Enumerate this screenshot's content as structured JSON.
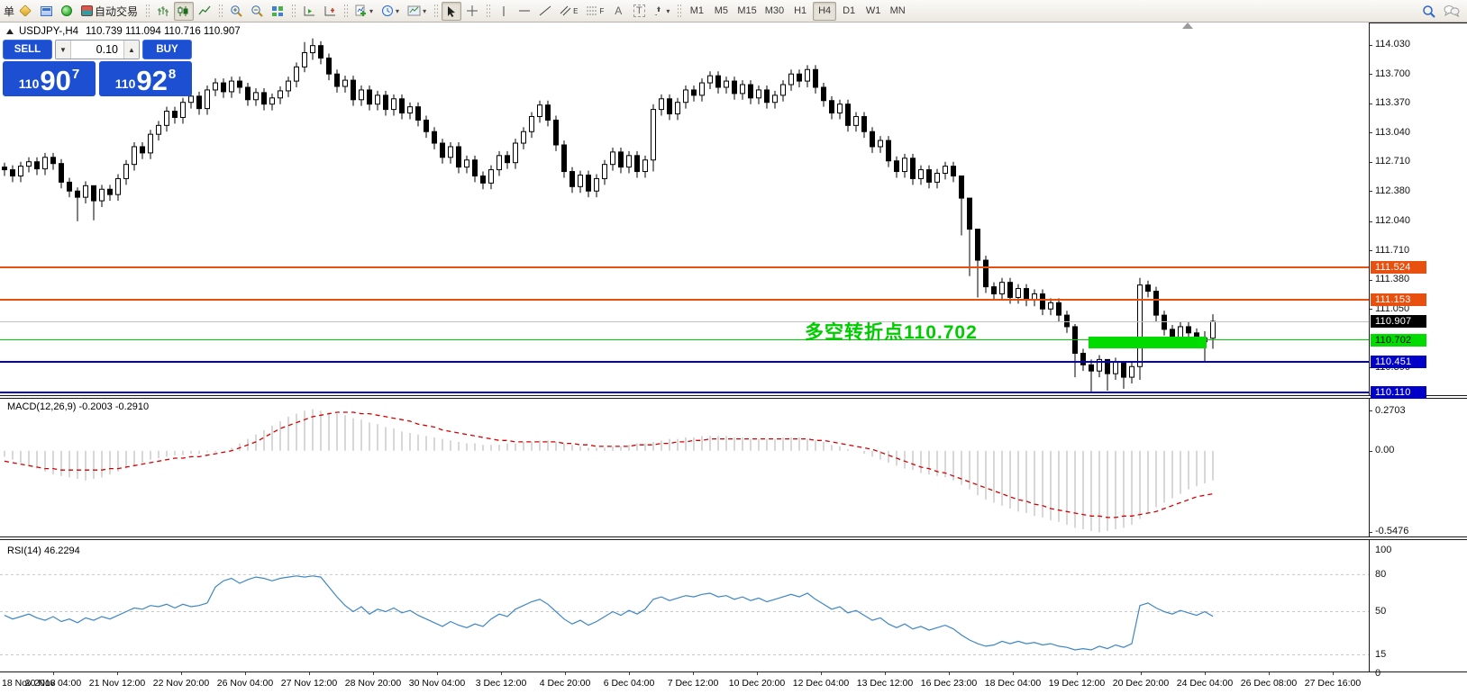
{
  "toolbar": {
    "order_label": "单",
    "autotrading_label": "自动交易",
    "timeframes": [
      "M1",
      "M5",
      "M15",
      "M30",
      "H1",
      "H4",
      "D1",
      "W1",
      "MN"
    ],
    "active_timeframe": "H4",
    "glyph_text": "A",
    "glyph_label": "T",
    "glyph_channel": "E",
    "glyph_fibo": "F"
  },
  "title": {
    "symbol": "USDJPY-,H4",
    "ohlc": "110.739 111.094 110.716 110.907"
  },
  "trade": {
    "sell": "SELL",
    "buy": "BUY",
    "volume": "0.10",
    "bid_prefix": "110",
    "bid_big": "90",
    "bid_sup": "7",
    "ask_prefix": "110",
    "ask_big": "92",
    "ask_sup": "8"
  },
  "annotation": {
    "text": "多空转折点110.702",
    "color": "#00CC00"
  },
  "axis": {
    "ticks": [
      "114.030",
      "113.700",
      "113.370",
      "113.040",
      "112.710",
      "112.380",
      "112.040",
      "111.710",
      "111.380",
      "111.050",
      "110.390"
    ],
    "badges": [
      {
        "text": "111.524",
        "price": 111.524,
        "bg": "#E8500F",
        "fg": "#FFFFFF"
      },
      {
        "text": "111.153",
        "price": 111.153,
        "bg": "#E8500F",
        "fg": "#FFFFFF"
      },
      {
        "text": "110.907",
        "price": 110.907,
        "bg": "#000000",
        "fg": "#FFFFFF"
      },
      {
        "text": "110.702",
        "price": 110.702,
        "bg": "#00DC00",
        "fg": "#000000"
      },
      {
        "text": "110.451",
        "price": 110.451,
        "bg": "#0000C8",
        "fg": "#FFFFFF"
      },
      {
        "text": "110.110",
        "price": 110.11,
        "bg": "#0000C8",
        "fg": "#FFFFFF"
      }
    ]
  },
  "levels": [
    {
      "price": 111.524,
      "color": "#E8500F",
      "w": 2
    },
    {
      "price": 111.153,
      "color": "#E8500F",
      "w": 2
    },
    {
      "price": 110.907,
      "color": "#C0C0C0",
      "w": 1
    },
    {
      "price": 110.702,
      "color": "#00CC00",
      "w": 1
    },
    {
      "price": 110.451,
      "color": "#0000C8",
      "w": 2
    },
    {
      "price": 110.11,
      "color": "#0000C8",
      "w": 2
    }
  ],
  "highlight_rect": {
    "color": "#00DC00"
  },
  "macd": {
    "label": "MACD(12,26,9) -0.2003 -0.2910",
    "axis_max": "0.2703",
    "axis_zero": "0.00",
    "axis_min": "-0.5476"
  },
  "rsi": {
    "label": "RSI(14) 46.2294",
    "axis": [
      100,
      80,
      50,
      15,
      0
    ]
  },
  "time_axis": [
    "18 Nov 2018",
    "20 Nov 04:00",
    "21 Nov 12:00",
    "22 Nov 20:00",
    "26 Nov 04:00",
    "27 Nov 12:00",
    "28 Nov 20:00",
    "30 Nov 04:00",
    "3 Dec 12:00",
    "4 Dec 20:00",
    "6 Dec 04:00",
    "7 Dec 12:00",
    "10 Dec 20:00",
    "12 Dec 04:00",
    "13 Dec 12:00",
    "16 Dec 23:00",
    "18 Dec 04:00",
    "19 Dec 12:00",
    "20 Dec 20:00",
    "24 Dec 04:00",
    "26 Dec 08:00",
    "27 Dec 16:00"
  ],
  "chart_data": {
    "type": "candlestick",
    "symbol": "USDJPY",
    "period": "H4",
    "price_axis_range": [
      110.05,
      114.27
    ],
    "candles": {
      "first_open": 112.65,
      "closes": [
        112.62,
        112.55,
        112.66,
        112.71,
        112.63,
        112.76,
        112.69,
        112.48,
        112.38,
        112.31,
        112.44,
        112.27,
        112.4,
        112.34,
        112.52,
        112.68,
        112.88,
        112.81,
        113.02,
        113.12,
        113.28,
        113.21,
        113.38,
        113.45,
        113.31,
        113.52,
        113.6,
        113.5,
        113.62,
        113.55,
        113.41,
        113.49,
        113.36,
        113.43,
        113.51,
        113.62,
        113.78,
        113.94,
        114.02,
        113.88,
        113.7,
        113.56,
        113.63,
        113.41,
        113.52,
        113.36,
        113.46,
        113.3,
        113.42,
        113.26,
        113.33,
        113.18,
        113.05,
        112.92,
        112.76,
        112.88,
        112.65,
        112.73,
        112.55,
        112.47,
        112.62,
        112.78,
        112.7,
        112.92,
        113.05,
        113.22,
        113.35,
        113.18,
        112.9,
        112.6,
        112.43,
        112.56,
        112.38,
        112.52,
        112.68,
        112.82,
        112.65,
        112.78,
        112.6,
        112.73,
        113.3,
        113.42,
        113.25,
        113.38,
        113.52,
        113.46,
        113.6,
        113.68,
        113.55,
        113.62,
        113.48,
        113.58,
        113.43,
        113.52,
        113.38,
        113.46,
        113.58,
        113.7,
        113.62,
        113.75,
        113.55,
        113.4,
        113.26,
        113.36,
        113.12,
        113.22,
        113.05,
        112.88,
        112.95,
        112.72,
        112.6,
        112.75,
        112.52,
        112.62,
        112.48,
        112.58,
        112.66,
        112.55,
        112.3,
        111.95,
        111.6,
        111.3,
        111.22,
        111.35,
        111.18,
        111.28,
        111.15,
        111.22,
        111.05,
        111.12,
        110.98,
        110.85,
        110.55,
        110.42,
        110.35,
        110.48,
        110.32,
        110.45,
        110.28,
        110.4,
        111.32,
        111.25,
        110.98,
        110.82,
        110.72,
        110.85,
        110.78,
        110.68,
        110.72,
        110.91
      ],
      "wick_overrides": {
        "9": [
          112.42,
          112.04
        ],
        "11": [
          112.38,
          112.05
        ],
        "37": [
          114.06,
          113.72
        ],
        "38": [
          114.1,
          113.86
        ],
        "80": [
          113.36,
          112.6
        ],
        "118": [
          112.52,
          111.88
        ],
        "119": [
          112.0,
          111.42
        ],
        "120": [
          111.68,
          111.18
        ],
        "132": [
          110.88,
          110.28
        ],
        "134": [
          110.48,
          110.12
        ],
        "136": [
          110.45,
          110.13
        ],
        "138": [
          110.38,
          110.15
        ],
        "140": [
          111.4,
          110.25
        ],
        "148": [
          110.8,
          110.45
        ],
        "149": [
          110.99,
          110.6
        ]
      }
    },
    "macd": {
      "histogram": [
        -0.04,
        -0.06,
        -0.08,
        -0.1,
        -0.12,
        -0.14,
        -0.16,
        -0.17,
        -0.18,
        -0.19,
        -0.2,
        -0.19,
        -0.18,
        -0.16,
        -0.14,
        -0.12,
        -0.1,
        -0.08,
        -0.06,
        -0.05,
        -0.04,
        -0.03,
        -0.03,
        -0.02,
        -0.02,
        -0.01,
        -0.01,
        0.0,
        0.02,
        0.05,
        0.08,
        0.11,
        0.14,
        0.17,
        0.2,
        0.23,
        0.25,
        0.27,
        0.28,
        0.27,
        0.26,
        0.25,
        0.24,
        0.22,
        0.21,
        0.19,
        0.18,
        0.16,
        0.15,
        0.13,
        0.12,
        0.11,
        0.1,
        0.09,
        0.08,
        0.07,
        0.06,
        0.05,
        0.05,
        0.04,
        0.04,
        0.04,
        0.05,
        0.05,
        0.06,
        0.06,
        0.07,
        0.07,
        0.06,
        0.05,
        0.04,
        0.03,
        0.02,
        0.02,
        0.02,
        0.03,
        0.03,
        0.04,
        0.05,
        0.05,
        0.06,
        0.07,
        0.08,
        0.08,
        0.09,
        0.09,
        0.1,
        0.1,
        0.1,
        0.1,
        0.09,
        0.09,
        0.08,
        0.08,
        0.08,
        0.08,
        0.09,
        0.09,
        0.09,
        0.08,
        0.07,
        0.06,
        0.04,
        0.03,
        0.01,
        0.0,
        -0.02,
        -0.04,
        -0.06,
        -0.08,
        -0.1,
        -0.12,
        -0.13,
        -0.15,
        -0.16,
        -0.17,
        -0.18,
        -0.2,
        -0.23,
        -0.26,
        -0.3,
        -0.33,
        -0.35,
        -0.37,
        -0.39,
        -0.41,
        -0.42,
        -0.44,
        -0.45,
        -0.47,
        -0.48,
        -0.5,
        -0.52,
        -0.53,
        -0.54,
        -0.55,
        -0.54,
        -0.53,
        -0.52,
        -0.5,
        -0.46,
        -0.42,
        -0.38,
        -0.35,
        -0.32,
        -0.29,
        -0.26,
        -0.24,
        -0.22,
        -0.2
      ],
      "signal": [
        -0.07,
        -0.08,
        -0.09,
        -0.1,
        -0.11,
        -0.12,
        -0.12,
        -0.13,
        -0.13,
        -0.13,
        -0.13,
        -0.13,
        -0.13,
        -0.12,
        -0.12,
        -0.11,
        -0.1,
        -0.09,
        -0.08,
        -0.07,
        -0.06,
        -0.05,
        -0.05,
        -0.04,
        -0.04,
        -0.03,
        -0.02,
        -0.01,
        0.0,
        0.02,
        0.04,
        0.06,
        0.09,
        0.12,
        0.15,
        0.17,
        0.19,
        0.21,
        0.23,
        0.24,
        0.25,
        0.26,
        0.26,
        0.26,
        0.25,
        0.25,
        0.24,
        0.23,
        0.22,
        0.21,
        0.2,
        0.18,
        0.17,
        0.16,
        0.14,
        0.13,
        0.12,
        0.11,
        0.1,
        0.09,
        0.08,
        0.07,
        0.07,
        0.06,
        0.06,
        0.06,
        0.06,
        0.06,
        0.06,
        0.05,
        0.05,
        0.04,
        0.04,
        0.03,
        0.03,
        0.03,
        0.03,
        0.03,
        0.04,
        0.04,
        0.04,
        0.05,
        0.05,
        0.06,
        0.06,
        0.07,
        0.07,
        0.08,
        0.08,
        0.08,
        0.08,
        0.08,
        0.08,
        0.08,
        0.08,
        0.08,
        0.08,
        0.08,
        0.08,
        0.08,
        0.07,
        0.07,
        0.06,
        0.05,
        0.04,
        0.03,
        0.02,
        0.01,
        -0.01,
        -0.03,
        -0.05,
        -0.07,
        -0.09,
        -0.11,
        -0.12,
        -0.14,
        -0.15,
        -0.17,
        -0.19,
        -0.21,
        -0.23,
        -0.25,
        -0.27,
        -0.29,
        -0.31,
        -0.33,
        -0.34,
        -0.36,
        -0.37,
        -0.39,
        -0.4,
        -0.41,
        -0.42,
        -0.43,
        -0.44,
        -0.44,
        -0.45,
        -0.45,
        -0.44,
        -0.44,
        -0.43,
        -0.42,
        -0.41,
        -0.39,
        -0.37,
        -0.35,
        -0.33,
        -0.31,
        -0.3,
        -0.29
      ]
    },
    "rsi": {
      "values": [
        47,
        44,
        46,
        48,
        45,
        43,
        46,
        42,
        44,
        41,
        45,
        43,
        46,
        44,
        47,
        50,
        53,
        52,
        55,
        54,
        56,
        53,
        56,
        54,
        55,
        57,
        70,
        75,
        77,
        73,
        76,
        78,
        77,
        75,
        77,
        78,
        79,
        78,
        79,
        78,
        70,
        62,
        55,
        50,
        54,
        48,
        52,
        50,
        53,
        49,
        51,
        47,
        44,
        41,
        38,
        42,
        39,
        37,
        40,
        38,
        44,
        48,
        46,
        52,
        55,
        58,
        60,
        56,
        50,
        44,
        40,
        43,
        39,
        42,
        46,
        50,
        47,
        51,
        48,
        52,
        60,
        62,
        59,
        61,
        63,
        62,
        64,
        65,
        62,
        63,
        60,
        62,
        59,
        61,
        58,
        60,
        62,
        64,
        62,
        65,
        60,
        56,
        52,
        54,
        49,
        51,
        47,
        43,
        45,
        40,
        37,
        40,
        36,
        38,
        35,
        37,
        39,
        36,
        31,
        27,
        24,
        22,
        23,
        26,
        24,
        26,
        24,
        25,
        23,
        24,
        22,
        21,
        19,
        20,
        19,
        22,
        20,
        23,
        21,
        24,
        55,
        57,
        53,
        50,
        48,
        51,
        49,
        47,
        50,
        46.23
      ],
      "levels": [
        80,
        50,
        15
      ]
    }
  }
}
